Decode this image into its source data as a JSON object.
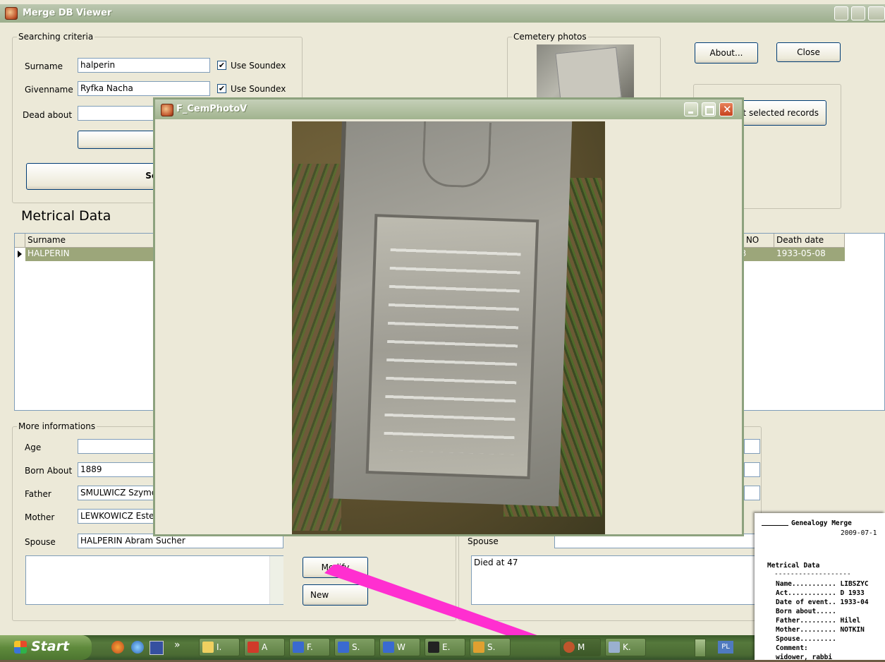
{
  "main_window": {
    "title": "Merge DB Viewer",
    "search_group": {
      "label": "Searching criteria",
      "surname_label": "Surname",
      "surname_value": "halperin",
      "givenname_label": "Givenname",
      "givenname_value": "Ryfka Nacha",
      "use_soundex_label": "Use Soundex",
      "dead_about_label": "Dead about",
      "dead_about_value": "",
      "search_button_partial": "Se"
    },
    "cemetery_group": {
      "label": "Cemetery photos"
    },
    "buttons": {
      "about": "About...",
      "close": "Close",
      "export_partial": "t selected records",
      "modify": "Modify",
      "new_partial": "New"
    },
    "metrical": {
      "title": "Metrical Data",
      "columns": [
        "Surname",
        "tz NO",
        "Death date"
      ],
      "row": {
        "surname": "HALPERIN",
        "act_partial": "23",
        "death_date": "1933-05-08"
      }
    },
    "more_group": {
      "label": "More informations",
      "age_label": "Age",
      "age_value": "",
      "born_label": "Born About",
      "born_value": "1889",
      "father_label": "Father",
      "father_value": "SMULWICZ Szymo",
      "mother_label": "Mother",
      "mother_value": "LEWKOWICZ Este",
      "spouse_label": "Spouse",
      "spouse_value": "HALPERIN Abram Sucher",
      "comment": "",
      "right_spouse_label": "Spouse",
      "right_spouse_value": "",
      "right_comment": "Died at 47"
    }
  },
  "popup": {
    "title": "F_CemPhotoV"
  },
  "taskbar": {
    "start": "Start",
    "items": [
      "I.",
      "A",
      "F.",
      "S.",
      "W",
      "E.",
      "S.",
      "M",
      "K."
    ],
    "lang": "PL"
  },
  "report": {
    "header": "Genealogy Merge",
    "date": "2009-07-1",
    "section": "Metrical Data",
    "rule": "-------------------",
    "lines": [
      "Name........... LIBSZYC",
      "Act............ D 1933",
      "Date of event.. 1933-04",
      "Born about.....",
      "Father......... Hilel",
      "Mother......... NOTKIN",
      "Spouse.........",
      "Comment:",
      "widower, rabbi"
    ]
  },
  "colors": {
    "titlebar": "#a9b89c",
    "selection": "#9ca67a",
    "arrow": "#ff2fd0",
    "window_face": "#ece9d8"
  }
}
